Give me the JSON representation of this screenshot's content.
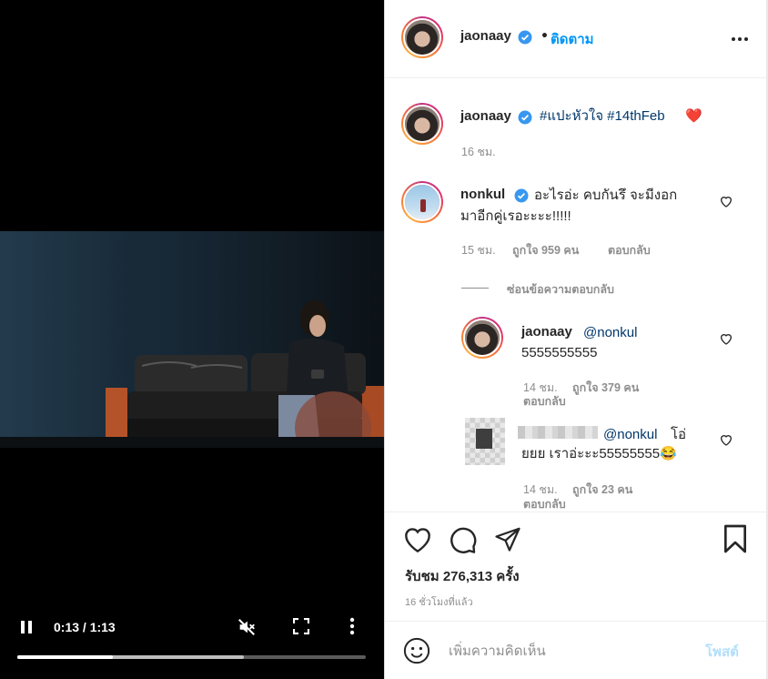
{
  "video": {
    "time_label": "0:13 / 1:13",
    "progress": 0.275,
    "buffered": 0.65
  },
  "header": {
    "username": "jaonaay",
    "dot": "•",
    "follow_label": "ติดตาม"
  },
  "caption": {
    "username": "jaonaay",
    "tags": "#แปะหัวใจ #14thFeb",
    "emoji": "❤️",
    "time": "16 ชม."
  },
  "comments": [
    {
      "username": "nonkul",
      "text_line1": "อะไรอ่ะ คบกันรึ จะมีงอก",
      "text_line2": "มาอีกคู่เรอะะะะ!!!!!",
      "time": "15 ชม.",
      "likes": "ถูกใจ 959 คน",
      "reply_label": "ตอบกลับ",
      "hide_replies_label": "ซ่อนข้อความตอบกลับ"
    }
  ],
  "replies": [
    {
      "username": "jaonaay",
      "mention": "@nonkul",
      "text": "5555555555",
      "time": "14 ชม.",
      "likes": "ถูกใจ 379 คน",
      "reply_label": "ตอบกลับ"
    },
    {
      "mention": "@nonkul",
      "text_line1_suffix": "โอ่",
      "text_line2": "ยยย เราอ่ะะะ55555555😂",
      "time": "14 ชม.",
      "likes": "ถูกใจ 23 คน",
      "reply_label": "ตอบกลับ"
    }
  ],
  "stats": {
    "views": "รับชม 276,313 ครั้ง",
    "posted_ago": "16 ชั่วโมงที่แล้ว"
  },
  "comment_box": {
    "placeholder": "เพิ่มความคิดเห็น",
    "post_label": "โพสต์"
  },
  "colors": {
    "accent": "#0095f6",
    "verified": "#3897f0",
    "hashtag": "#00376b",
    "post_disabled": "#b2dffc"
  },
  "icons": {
    "like": "heart-icon",
    "comment": "comment-bubble-icon",
    "share": "paper-plane-icon",
    "save": "bookmark-icon",
    "emoji": "smiley-icon",
    "options": "more-horizontal-icon"
  }
}
